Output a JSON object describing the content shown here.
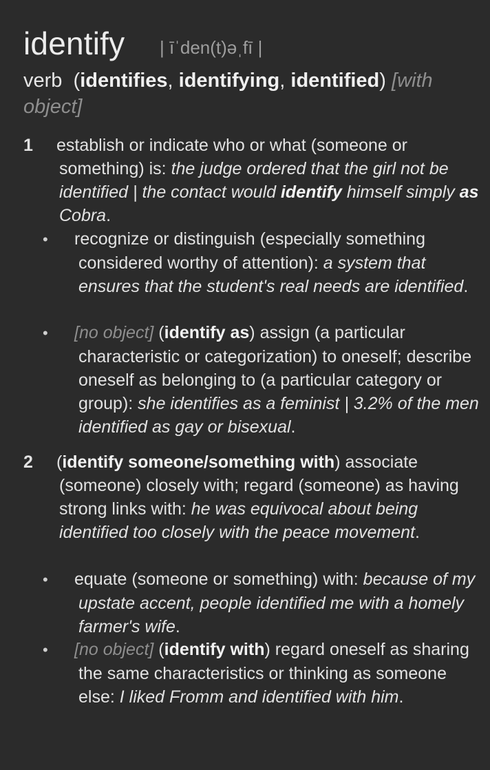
{
  "entry": {
    "headword": "identify",
    "pronunciation": "| īˈden(t)əˌfī |",
    "pos": "verb",
    "forms_open": "(",
    "form1": "identifies",
    "form2": "identifying",
    "form3": "identified",
    "forms_close": ")",
    "grammar": "[with object]"
  },
  "senses": [
    {
      "number": "1",
      "def": "establish or indicate who or what (someone or something) is: ",
      "ex1": "the judge ordered that the girl not be identified",
      "sep": " | ",
      "ex2a": "the contact would ",
      "ex2b": "identify",
      "ex2c": " himself simply ",
      "ex2d": "as",
      "ex2e": " Cobra",
      "end": "."
    },
    {
      "number": "2",
      "phrase": "identify someone/something with",
      "def": ") associate (someone) closely with; regard (someone) as having strong links with: ",
      "ex": "he was equivocal about being identified too closely with the peace movement",
      "end": "."
    }
  ],
  "subsenses": [
    {
      "bullet": "•",
      "def": "recognize or distinguish (especially something considered worthy of attention): ",
      "ex": "a system that ensures that the student's real needs are identified",
      "end": "."
    },
    {
      "bullet": "•",
      "gram": "[no object]",
      "phrase": "identify as",
      "def": ") assign (a particular characteristic or categorization) to oneself; describe oneself as belonging to (a particular category or group): ",
      "ex1": "she identifies as a feminist",
      "sep": " | ",
      "ex2": "3.2% of the men identified as gay or bisexual",
      "end": "."
    },
    {
      "bullet": "•",
      "def": "equate (someone or something) with: ",
      "ex": "because of my upstate accent, people identified me with a homely farmer's wife",
      "end": "."
    },
    {
      "bullet": "•",
      "gram": "[no object]",
      "phrase": "identify with",
      "def": ") regard oneself as sharing the same characteristics or thinking as someone else: ",
      "ex": "I liked Fromm and identified with him",
      "end": "."
    }
  ]
}
